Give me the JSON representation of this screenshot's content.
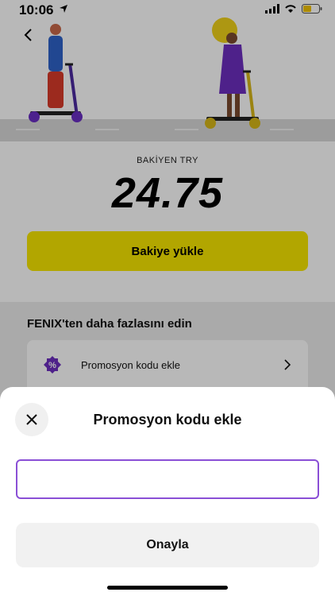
{
  "status_bar": {
    "time": "10:06"
  },
  "balance": {
    "label": "BAKİYEN  TRY",
    "value": "24.75"
  },
  "topup_button": {
    "label": "Bakiye yükle"
  },
  "more_section": {
    "title": "FENIX'ten daha fazlasını edin",
    "items": [
      {
        "label": "Promosyon kodu ekle",
        "icon": "promo-badge-icon"
      }
    ]
  },
  "sheet": {
    "title": "Promosyon kodu ekle",
    "input_value": "",
    "input_placeholder": "",
    "confirm_label": "Onayla"
  },
  "colors": {
    "accent_yellow": "#f7e600",
    "accent_purple": "#8a4fd6"
  }
}
